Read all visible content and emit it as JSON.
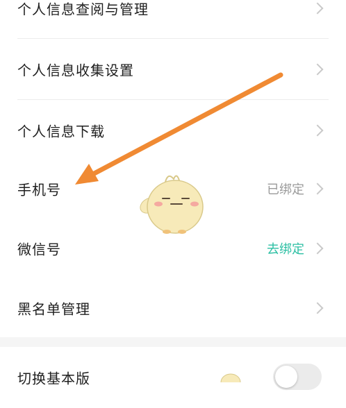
{
  "menu": {
    "items": [
      {
        "label": "个人信息查阅与管理"
      },
      {
        "label": "个人信息收集设置"
      },
      {
        "label": "个人信息下载"
      },
      {
        "label": "手机号",
        "value": "已绑定"
      },
      {
        "label": "微信号",
        "value": "去绑定"
      },
      {
        "label": "黑名单管理"
      }
    ]
  },
  "settings": {
    "basic_mode_label": "切换基本版",
    "basic_mode_enabled": false
  },
  "colors": {
    "accent_teal": "#2bbfa3",
    "muted_value": "#9a9a9a",
    "arrow_orange": "#f08a33",
    "mascot_yellow": "#f7eab9"
  }
}
